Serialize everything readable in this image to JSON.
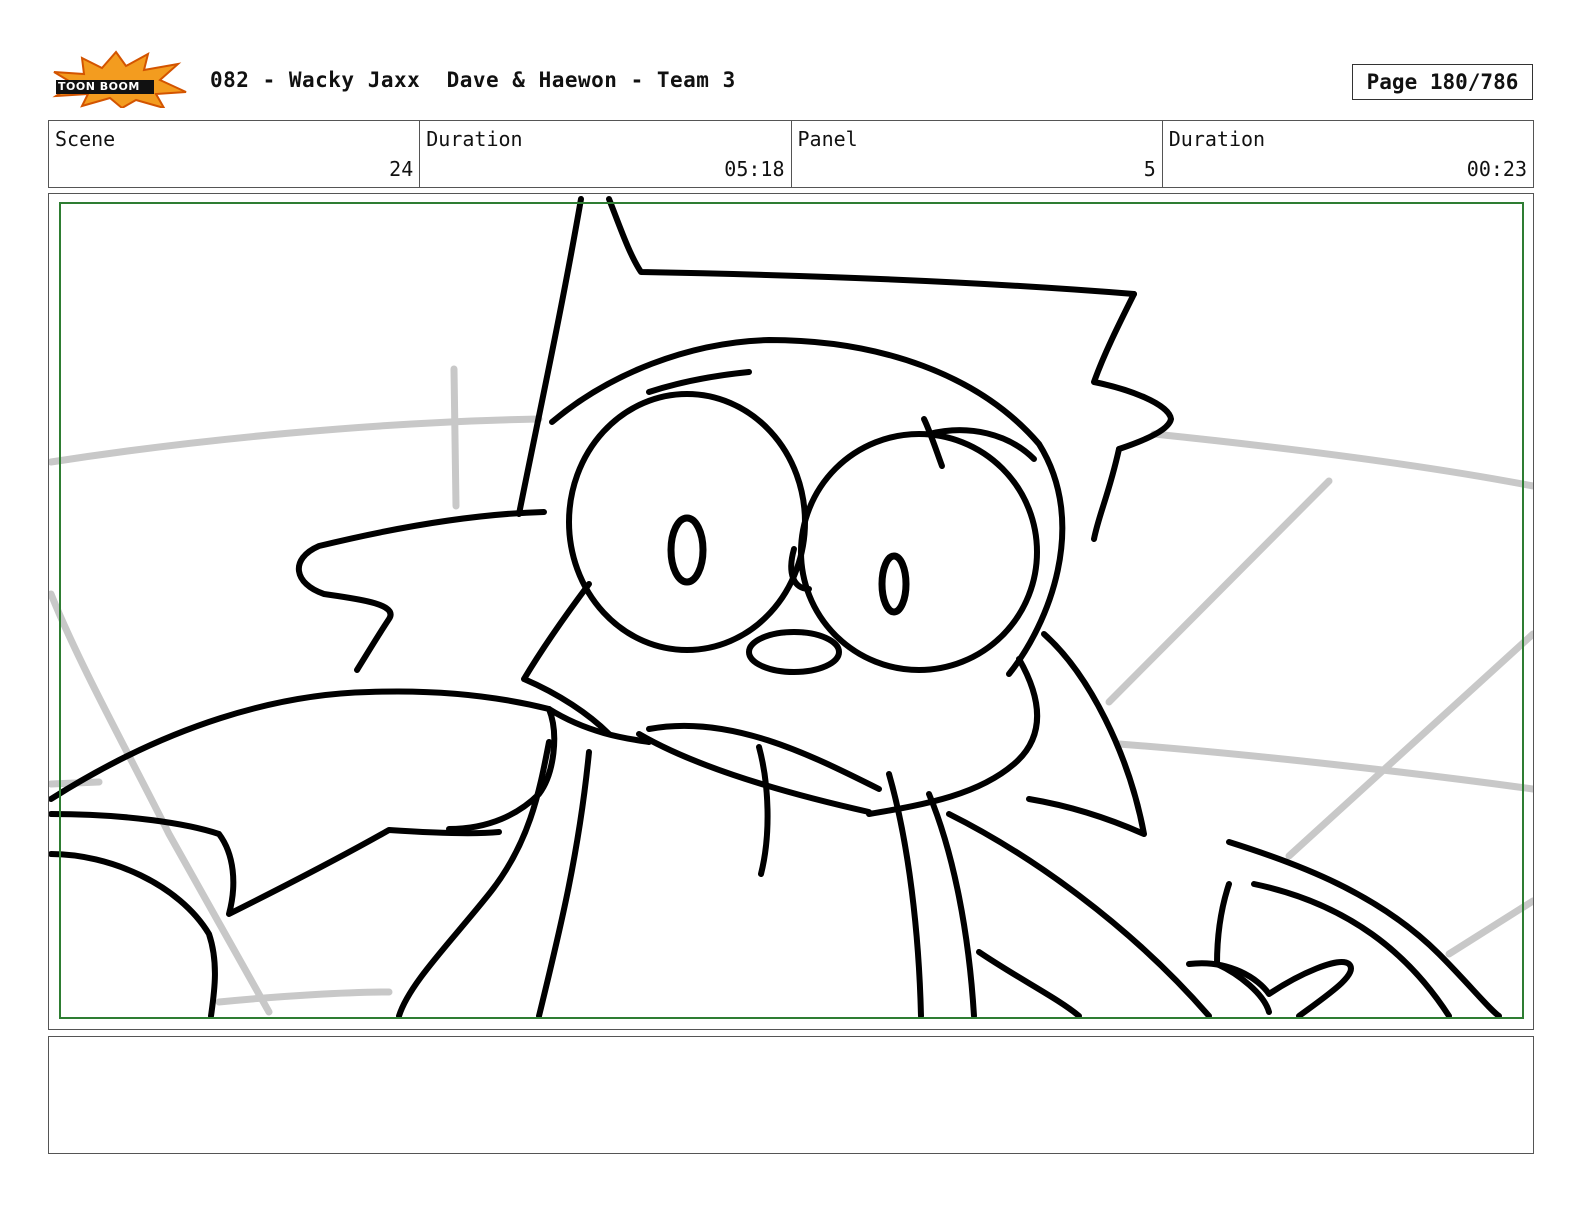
{
  "header": {
    "logo_text": "TOON BOOM",
    "title": "082 - Wacky Jaxx  Dave & Haewon - Team 3",
    "page": "Page 180/786"
  },
  "info": {
    "scene_label": "Scene",
    "scene_value": "24",
    "scene_duration_label": "Duration",
    "scene_duration_value": "05:18",
    "panel_label": "Panel",
    "panel_value": "5",
    "panel_duration_label": "Duration",
    "panel_duration_value": "00:23"
  },
  "notes": {
    "text": ""
  },
  "colors": {
    "safe_frame": "#2e7d32",
    "logo_burst": "#f39c1f",
    "sketch_line": "#000000",
    "background_sketch": "#c8c8c8"
  }
}
